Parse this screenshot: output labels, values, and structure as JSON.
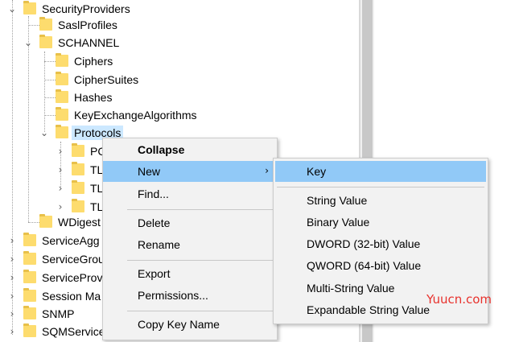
{
  "tree": {
    "nodes": [
      {
        "label": "SecurityProviders",
        "expander": "collapse"
      },
      {
        "label": "SaslProfiles",
        "expander": "none"
      },
      {
        "label": "SCHANNEL",
        "expander": "collapse"
      },
      {
        "label": "Ciphers",
        "expander": "none"
      },
      {
        "label": "CipherSuites",
        "expander": "none"
      },
      {
        "label": "Hashes",
        "expander": "none"
      },
      {
        "label": "KeyExchangeAlgorithms",
        "expander": "none"
      },
      {
        "label": "Protocols",
        "expander": "collapse",
        "selected": true
      },
      {
        "label": "PC",
        "expander": "expand"
      },
      {
        "label": "TL",
        "expander": "expand"
      },
      {
        "label": "TL",
        "expander": "expand"
      },
      {
        "label": "TL",
        "expander": "expand"
      },
      {
        "label": "WDigest",
        "expander": "none"
      },
      {
        "label": "ServiceAgg",
        "expander": "expand"
      },
      {
        "label": "ServiceGrou",
        "expander": "expand"
      },
      {
        "label": "ServiceProv",
        "expander": "expand"
      },
      {
        "label": "Session Ma",
        "expander": "expand"
      },
      {
        "label": "SNMP",
        "expander": "expand"
      },
      {
        "label": "SQMService",
        "expander": "expand"
      }
    ]
  },
  "context_menu": {
    "collapse": "Collapse",
    "new": "New",
    "find": "Find...",
    "delete": "Delete",
    "rename": "Rename",
    "export": "Export",
    "permissions": "Permissions...",
    "copy_key_name": "Copy Key Name"
  },
  "submenu": {
    "key": "Key",
    "string_value": "String Value",
    "binary_value": "Binary Value",
    "dword_value": "DWORD (32-bit) Value",
    "qword_value": "QWORD (64-bit) Value",
    "multi_string_value": "Multi-String Value",
    "expandable_string_value": "Expandable String Value"
  },
  "watermark": "Yuucn.com",
  "colors": {
    "selection": "#cce8ff",
    "menu_hover": "#91c9f7",
    "folder": "#fddc6e",
    "watermark": "#e8322d"
  },
  "icons": {
    "folder": "folder-icon",
    "expand": "chevron-right-icon",
    "collapse": "chevron-down-icon"
  }
}
